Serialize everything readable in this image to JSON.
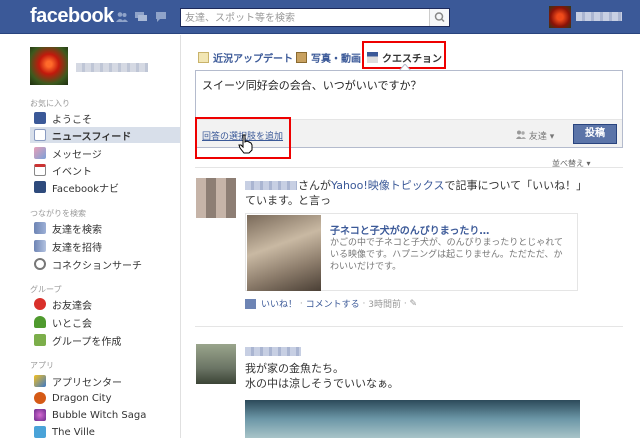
{
  "topbar": {
    "logo": "facebook",
    "search_placeholder": "友達、スポット等を検索"
  },
  "sidebar": {
    "section_favorites": "お気に入り",
    "favorites": [
      {
        "label": "ようこそ",
        "icon": "facebook-f-icon"
      },
      {
        "label": "ニュースフィード",
        "icon": "news-feed-icon"
      },
      {
        "label": "メッセージ",
        "icon": "messages-icon"
      },
      {
        "label": "イベント",
        "icon": "calendar-icon"
      },
      {
        "label": "Facebookナビ",
        "icon": "navi-icon"
      }
    ],
    "section_connect": "つながりを検索",
    "connect": [
      {
        "label": "友達を検索",
        "icon": "find-friends-icon"
      },
      {
        "label": "友達を招待",
        "icon": "invite-friends-icon"
      },
      {
        "label": "コネクションサーチ",
        "icon": "magnifier-icon"
      }
    ],
    "section_groups": "グループ",
    "groups": [
      {
        "label": "お友達会",
        "icon": "apple-icon"
      },
      {
        "label": "いとこ会",
        "icon": "tree-icon"
      },
      {
        "label": "グループを作成",
        "icon": "create-group-icon"
      }
    ],
    "section_apps": "アプリ",
    "apps": [
      {
        "label": "アプリセンター",
        "icon": "app-center-icon"
      },
      {
        "label": "Dragon City",
        "icon": "dragon-city-icon"
      },
      {
        "label": "Bubble Witch Saga",
        "icon": "bubble-witch-icon"
      },
      {
        "label": "The Ville",
        "icon": "the-ville-icon"
      }
    ]
  },
  "composer": {
    "tabs": [
      "近況アップデート",
      "写真・動画",
      "クエスチョン"
    ],
    "question_text": "スイーツ同好会の会合、いつがいいですか？",
    "add_option": "回答の選択肢を追加",
    "audience": "友達",
    "post_button": "投稿",
    "sort_label": "並べ替え"
  },
  "feed": {
    "post1": {
      "text_line1_link_prefix": "さんが",
      "app_link": "Yahoo!映像トピックス",
      "text_line1_suffix": "で記事について「いいね！」と言っ",
      "text_line2": "ています。",
      "attachment_title": "子ネコと子犬がのんびりまったり…",
      "attachment_desc": "かごの中で子ネコと子犬が、のんびりまったりとじゃれている映像です。ハプニングは起こりません。ただただ、かわいいだけです。",
      "like": "いいね！",
      "comment": "コメントする",
      "time": "3時間前"
    },
    "post2": {
      "line1": "我が家の金魚たち。",
      "line2": "水の中は涼しそうでいいなぁ。"
    }
  },
  "colors": {
    "brand_blue": "#3b5998",
    "highlight_red": "#ee0000"
  }
}
